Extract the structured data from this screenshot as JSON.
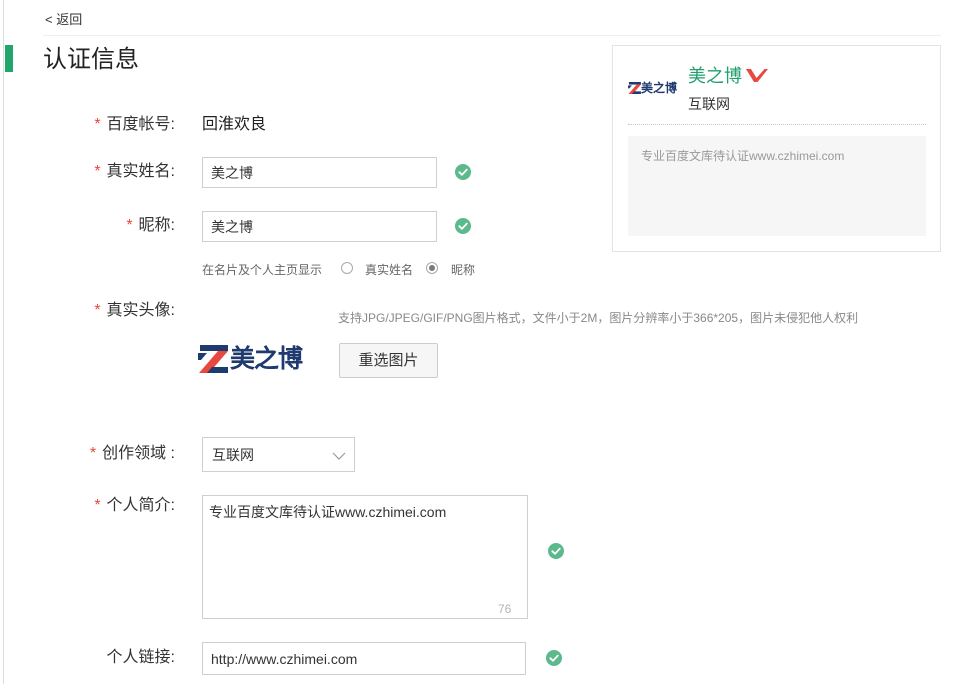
{
  "nav": {
    "back_label": "< 返回"
  },
  "page": {
    "title": "认证信息"
  },
  "form": {
    "required_mark": "*",
    "account": {
      "label": "百度帐号:",
      "value": "回淮欢良"
    },
    "real_name": {
      "label": "真实姓名:",
      "value": "美之博"
    },
    "nickname": {
      "label": "昵称:",
      "value": "美之博"
    },
    "display": {
      "label": "在名片及个人主页显示",
      "options": [
        "真实姓名",
        "昵称"
      ],
      "selected": "昵称"
    },
    "avatar": {
      "label": "真实头像:",
      "hint": "支持JPG/JPEG/GIF/PNG图片格式，文件小于2M，图片分辨率小于366*205，图片未侵犯他人权利",
      "logo_text": "美之博",
      "reselect_label": "重选图片"
    },
    "field": {
      "label": "创作领域 :",
      "value": "互联网"
    },
    "intro": {
      "label": "个人简介:",
      "value": "专业百度文库待认证www.czhimei.com",
      "counter": "76"
    },
    "link": {
      "label": "个人链接:",
      "value": "http://www.czhimei.com"
    }
  },
  "preview": {
    "logo_text": "美之博",
    "name": "美之博",
    "category": "互联网",
    "intro": "专业百度文库待认证www.czhimei.com"
  },
  "colors": {
    "accent_green": "#21a56b",
    "valid_green": "#5bb98b",
    "brand_name_green": "#21a06e",
    "required_red": "#e8483f",
    "badge_red": "#e8483f",
    "logo_navy": "#1f3a6e"
  },
  "icons": {
    "valid": "check-circle-icon",
    "dropdown": "chevron-down-icon",
    "verified": "verified-v-icon",
    "logo": "brand-z-logo-icon"
  }
}
